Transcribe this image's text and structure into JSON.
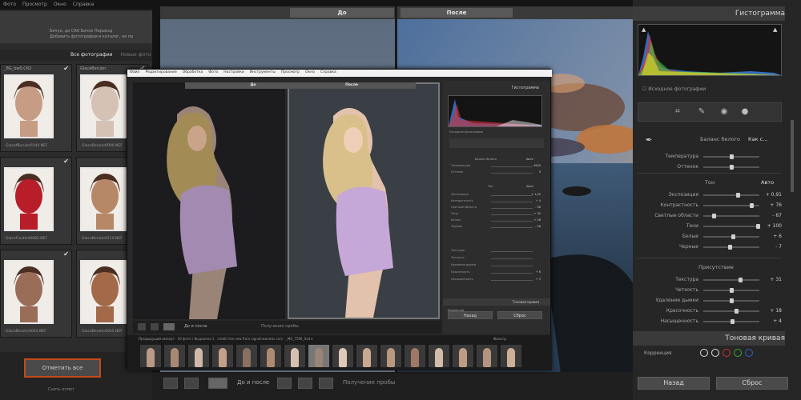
{
  "left_panel": {
    "menu": [
      "Фото",
      "Просмотр",
      "Окно",
      "Справка"
    ],
    "source_info": [
      "Бичук, до CR6      Бичок      Переезд",
      "Добавить фотографии в каталог, не пе"
    ],
    "tabs": [
      "Все фотографии",
      "Новые фото"
    ],
    "photos": [
      {
        "filename": "_BG_bw0.CR2",
        "caption": "GlacefBeruler0144.NEF",
        "checked": "✔",
        "tone": "#c69c84"
      },
      {
        "filename": "GlaceBeruler",
        "caption": "GlaceBeruler0090.NEF",
        "checked": "✔",
        "tone": "#d6c2b4"
      },
      {
        "filename": "",
        "caption": "GlaceFluidled0082.NEF",
        "checked": "✔",
        "tone": "#b81d2a"
      },
      {
        "filename": "",
        "caption": "GlaceBeruler0119.NEF",
        "checked": "✔",
        "tone": "#b68868"
      },
      {
        "filename": "",
        "caption": "GlaceBeruler0042.NEF",
        "checked": "✔",
        "tone": "#9a6d58"
      },
      {
        "filename": "",
        "caption": "GlaceBeruler0045.NEF",
        "checked": "✔",
        "tone": "#a36a4a"
      }
    ],
    "check_all_button": "Отметить все",
    "uncheck_label": "Снять отмет"
  },
  "main": {
    "before_label": "До",
    "after_label": "После",
    "view_label": "До и после",
    "soft_proof_label": "Получение пробы"
  },
  "right_panel": {
    "histogram_title": "Гистограмма",
    "original_photo_label": "Исходное фотографии",
    "wb_section": "Баланс белого",
    "wb_value": "Как с...",
    "tone_section": "Тон",
    "tone_auto": "Авто",
    "presence_section": "Присутствие",
    "sliders_wb": [
      {
        "label": "Температура",
        "value": "",
        "pos": 0.5
      },
      {
        "label": "Оттенок",
        "value": "",
        "pos": 0.5
      }
    ],
    "sliders_tone": [
      {
        "label": "Экспозиция",
        "value": "+ 0,91",
        "pos": 0.62
      },
      {
        "label": "Контрастность",
        "value": "+ 76",
        "pos": 0.88
      },
      {
        "label": "Светлые области",
        "value": "- 67",
        "pos": 0.17
      },
      {
        "label": "Тени",
        "value": "+ 100",
        "pos": 1.0
      },
      {
        "label": "Белые",
        "value": "+ 6",
        "pos": 0.53
      },
      {
        "label": "Черные",
        "value": "- 7",
        "pos": 0.47
      }
    ],
    "sliders_presence": [
      {
        "label": "Текстура",
        "value": "+ 31",
        "pos": 0.66
      },
      {
        "label": "Четкость",
        "value": "",
        "pos": 0.5
      },
      {
        "label": "Удаление дымки",
        "value": "",
        "pos": 0.5
      },
      {
        "label": "Красочность",
        "value": "+ 18",
        "pos": 0.59
      },
      {
        "label": "Насыщенность",
        "value": "+ 4",
        "pos": 0.52
      }
    ],
    "tone_curve_title": "Тоновая кривая",
    "correction_label": "Коррекция",
    "back_button": "Назад",
    "reset_button": "Сброс"
  },
  "window": {
    "menu": [
      "Файл",
      "Редактирование",
      "Обработка",
      "Фото",
      "Настройки",
      "Инструменты",
      "Просмотр",
      "Окно",
      "Справка"
    ],
    "before_label": "До",
    "after_label": "После",
    "histogram_title": "Гистограмма",
    "original_photo_label": "Исходное фотографии",
    "wb_label": "Баланс белого",
    "wb_value": "Авто",
    "tone_label": "Тон",
    "tone_auto": "Авто",
    "view_label": "До и после",
    "soft_proof_label": "Получение пробы",
    "sliders": [
      {
        "label": "Температура",
        "value": "4900"
      },
      {
        "label": "Оттенок",
        "value": "0"
      },
      {
        "label": "Экспозиция",
        "value": "+ 1,00"
      },
      {
        "label": "Контрастность",
        "value": "+ 4"
      },
      {
        "label": "Светлые области",
        "value": "- 56"
      },
      {
        "label": "Тени",
        "value": "+ 30"
      },
      {
        "label": "Белые",
        "value": "+ 26"
      },
      {
        "label": "Черные",
        "value": "- 28"
      },
      {
        "label": "Текстура",
        "value": ""
      },
      {
        "label": "Четкость",
        "value": ""
      },
      {
        "label": "Удаление дымки",
        "value": ""
      },
      {
        "label": "Красочность",
        "value": "+ 6"
      },
      {
        "label": "Насыщенность",
        "value": "+ 3"
      }
    ],
    "tone_curve_label": "Тоновая кривая",
    "correction_label": "Коррекция",
    "back_button": "Назад",
    "reset_button": "Сброс",
    "filmstrip_path": "Предыдущий импорт · 30 фото / Выделено 1 · credit free new from signalnewsmtc.com · _MG_7596_Svd ▾",
    "filter_label": "Фильтр:",
    "thumb_count": 16
  },
  "colors": {
    "accent_orange": "#c34a1a",
    "panel_bg": "#262626",
    "slider_knob": "#cfcfcf"
  }
}
